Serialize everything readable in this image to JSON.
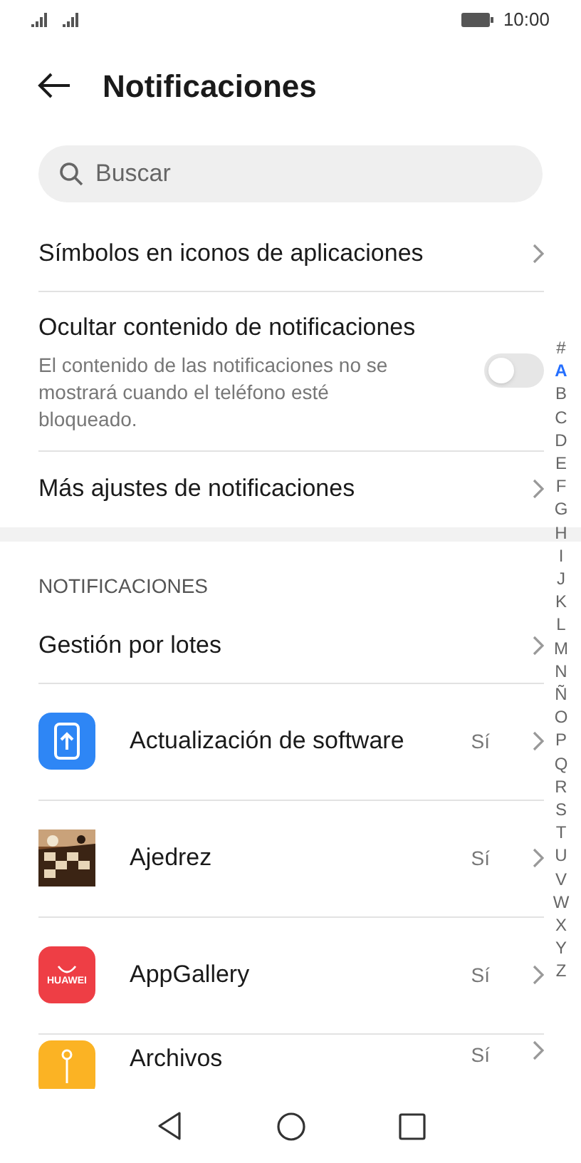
{
  "status_bar": {
    "time": "10:00"
  },
  "header": {
    "title": "Notificaciones"
  },
  "search": {
    "placeholder": "Buscar"
  },
  "settings": [
    {
      "kind": "link",
      "label": "Símbolos en iconos de aplicaciones"
    },
    {
      "kind": "toggle",
      "label": "Ocultar contenido de notificaciones",
      "description": "El contenido de las notificaciones no se mostrará cuando el teléfono esté bloqueado.",
      "on": false
    },
    {
      "kind": "link",
      "label": "Más ajustes de notificaciones"
    }
  ],
  "section": {
    "title": "NOTIFICACIONES",
    "batch": "Gestión por lotes"
  },
  "apps": [
    {
      "kind": "update",
      "name": "Actualización de software",
      "value": "Sí"
    },
    {
      "kind": "picture",
      "name": "Ajedrez",
      "value": "Sí"
    },
    {
      "kind": "store",
      "name": "AppGallery",
      "value": "Sí",
      "icon_text": "HUAWEI"
    },
    {
      "kind": "files",
      "name": "Archivos",
      "value": "Sí"
    }
  ],
  "index": [
    {
      "letter": "#",
      "selected": false
    },
    {
      "letter": "A",
      "selected": true
    },
    {
      "letter": "B",
      "selected": false
    },
    {
      "letter": "C",
      "selected": false
    },
    {
      "letter": "D",
      "selected": false
    },
    {
      "letter": "E",
      "selected": false
    },
    {
      "letter": "F",
      "selected": false
    },
    {
      "letter": "G",
      "selected": false
    },
    {
      "letter": "H",
      "selected": false
    },
    {
      "letter": "I",
      "selected": false
    },
    {
      "letter": "J",
      "selected": false
    },
    {
      "letter": "K",
      "selected": false
    },
    {
      "letter": "L",
      "selected": false
    },
    {
      "letter": "M",
      "selected": false
    },
    {
      "letter": "N",
      "selected": false
    },
    {
      "letter": "Ñ",
      "selected": false
    },
    {
      "letter": "O",
      "selected": false
    },
    {
      "letter": "P",
      "selected": false
    },
    {
      "letter": "Q",
      "selected": false
    },
    {
      "letter": "R",
      "selected": false
    },
    {
      "letter": "S",
      "selected": false
    },
    {
      "letter": "T",
      "selected": false
    },
    {
      "letter": "U",
      "selected": false
    },
    {
      "letter": "V",
      "selected": false
    },
    {
      "letter": "W",
      "selected": false
    },
    {
      "letter": "X",
      "selected": false
    },
    {
      "letter": "Y",
      "selected": false
    },
    {
      "letter": "Z",
      "selected": false
    }
  ]
}
